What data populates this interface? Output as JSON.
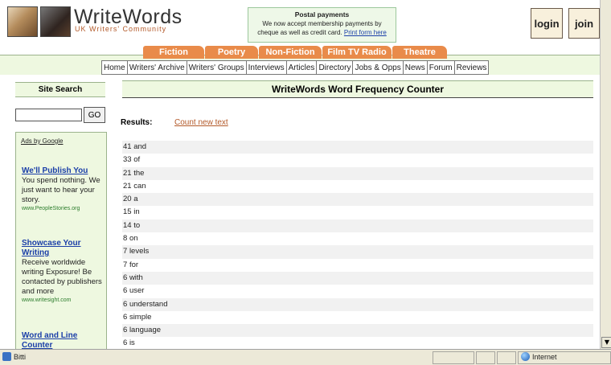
{
  "site": {
    "brand": "WriteWords",
    "tagline": "UK Writers' Community"
  },
  "notice": {
    "title": "Postal payments",
    "line1": "We now accept membership payments by",
    "line2": "cheque as well as credit card.",
    "link": "Print form here"
  },
  "header": {
    "login_label": "login",
    "join_label": "join"
  },
  "categories": [
    "Fiction",
    "Poetry",
    "Non-Fiction",
    "Film TV Radio",
    "Theatre"
  ],
  "subnav": [
    "Home",
    "Writers' Archive",
    "Writers' Groups",
    "Interviews",
    "Articles",
    "Directory",
    "Jobs & Opps",
    "News",
    "Forum",
    "Reviews"
  ],
  "sidebar": {
    "search_title": "Site Search",
    "search_value": "",
    "go_label": "GO",
    "ads_heading": "Ads by Google",
    "ads": [
      {
        "title": "We'll Publish You",
        "body": "You spend nothing. We just want to hear your story.",
        "url": "www.PeopleStories.org"
      },
      {
        "title": "Showcase Your Writing",
        "body": "Receive worldwide writing Exposure! Be contacted by publishers and more",
        "url": "www.writesight.com"
      },
      {
        "title": "Word and Line Counter",
        "body": "",
        "url": ""
      }
    ]
  },
  "main": {
    "title": "WriteWords Word Frequency Counter",
    "results_label": "Results:",
    "count_new_label": "Count new text",
    "frequencies": [
      {
        "count": "41",
        "word": "and"
      },
      {
        "count": "33",
        "word": "of"
      },
      {
        "count": "21",
        "word": "the"
      },
      {
        "count": "21",
        "word": "can"
      },
      {
        "count": "20",
        "word": "a"
      },
      {
        "count": "15",
        "word": "in"
      },
      {
        "count": "14",
        "word": "to"
      },
      {
        "count": "8",
        "word": "on"
      },
      {
        "count": "7",
        "word": "levels"
      },
      {
        "count": "7",
        "word": "for"
      },
      {
        "count": "6",
        "word": "with"
      },
      {
        "count": "6",
        "word": "user"
      },
      {
        "count": "6",
        "word": "understand"
      },
      {
        "count": "6",
        "word": "simple"
      },
      {
        "count": "6",
        "word": "language"
      },
      {
        "count": "6",
        "word": "is"
      }
    ]
  },
  "statusbar": {
    "status_text": "Bitti",
    "zone_text": "Internet"
  },
  "icons": {
    "logo_a": "quill-writing-icon",
    "logo_b": "books-icon",
    "status": "ie-page-icon",
    "zone": "globe-icon",
    "scroll": "arrow-down-icon"
  },
  "colors": {
    "tab_orange": "#e98b4a",
    "band_green": "#eef8e0",
    "link_blue": "#1a3ea8",
    "link_orange": "#b35a2a"
  }
}
